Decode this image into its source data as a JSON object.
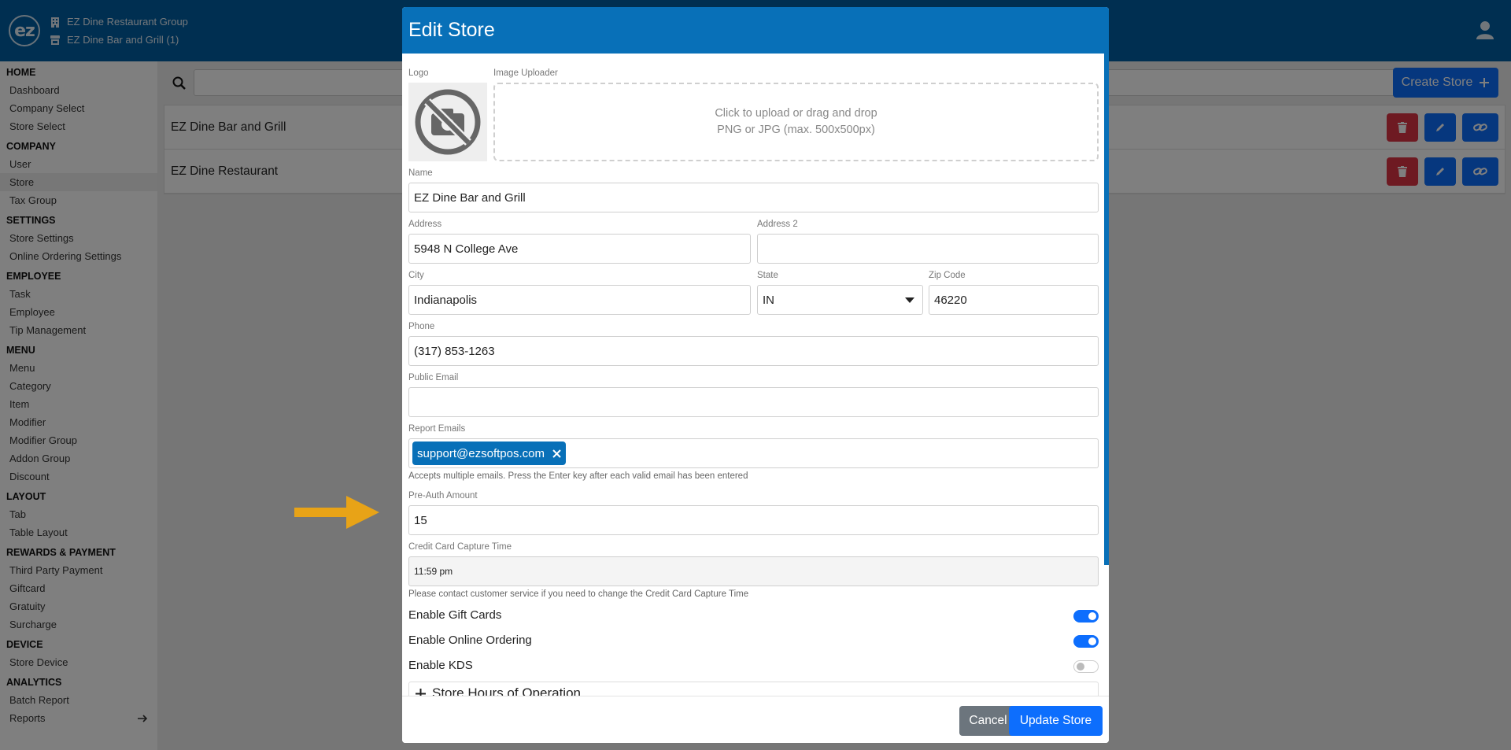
{
  "topbar": {
    "logo_text": "ez",
    "company_group": "EZ Dine Restaurant Group",
    "current_store": "EZ Dine Bar and Grill (1)"
  },
  "sidebar": {
    "sections": [
      {
        "title": "HOME",
        "items": [
          "Dashboard",
          "Company Select",
          "Store Select"
        ]
      },
      {
        "title": "COMPANY",
        "items": [
          "User",
          "Store",
          "Tax Group"
        ]
      },
      {
        "title": "SETTINGS",
        "items": [
          "Store Settings",
          "Online Ordering Settings"
        ]
      },
      {
        "title": "EMPLOYEE",
        "items": [
          "Task",
          "Employee",
          "Tip Management"
        ]
      },
      {
        "title": "MENU",
        "items": [
          "Menu",
          "Category",
          "Item",
          "Modifier",
          "Modifier Group",
          "Addon Group",
          "Discount"
        ]
      },
      {
        "title": "LAYOUT",
        "items": [
          "Tab",
          "Table Layout"
        ]
      },
      {
        "title": "REWARDS & PAYMENT",
        "items": [
          "Third Party Payment",
          "Giftcard",
          "Gratuity",
          "Surcharge"
        ]
      },
      {
        "title": "DEVICE",
        "items": [
          "Store Device"
        ]
      },
      {
        "title": "ANALYTICS",
        "items": [
          "Batch Report",
          "Reports"
        ]
      }
    ],
    "active_item": "Store"
  },
  "main": {
    "create_button": "Create Store",
    "stores": [
      "EZ Dine Bar and Grill",
      "EZ Dine Restaurant"
    ]
  },
  "modal": {
    "title": "Edit Store",
    "logo_label": "Logo",
    "uploader_label": "Image Uploader",
    "uploader_line1": "Click to upload or drag and drop",
    "uploader_line2": "PNG or JPG (max. 500x500px)",
    "name_label": "Name",
    "name_value": "EZ Dine Bar and Grill",
    "address_label": "Address",
    "address_value": "5948 N College Ave",
    "address2_label": "Address 2",
    "address2_value": "",
    "city_label": "City",
    "city_value": "Indianapolis",
    "state_label": "State",
    "state_value": "IN",
    "zip_label": "Zip Code",
    "zip_value": "46220",
    "phone_label": "Phone",
    "phone_value": "(317) 853-1263",
    "public_email_label": "Public Email",
    "public_email_value": "",
    "report_emails_label": "Report Emails",
    "report_email_chip": "support@ezsoftpos.com",
    "report_emails_help": "Accepts multiple emails. Press the Enter key after each valid email has been entered",
    "preauth_label": "Pre-Auth Amount",
    "preauth_value": "15",
    "capture_label": "Credit Card Capture Time",
    "capture_value": "11:59 pm",
    "capture_help": "Please contact customer service if you need to change the Credit Card Capture Time",
    "toggles": [
      {
        "label": "Enable Gift Cards",
        "on": true
      },
      {
        "label": "Enable Online Ordering",
        "on": true
      },
      {
        "label": "Enable KDS",
        "on": false
      }
    ],
    "hours_label": "Store Hours of Operation",
    "cancel_button": "Cancel",
    "update_button": "Update Store"
  },
  "colors": {
    "header_blue": "#005fa3",
    "modal_header": "#0870b8",
    "primary": "#0d6efd",
    "danger": "#dc3545",
    "arrow": "#e8a317"
  }
}
